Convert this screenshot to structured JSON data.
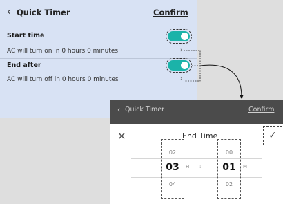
{
  "screen1": {
    "back_icon": "chevron-left-icon",
    "title": "Quick Timer",
    "confirm_label": "Confirm",
    "start_time": {
      "label": "Start time",
      "subtext": "AC will turn on in 0 hours 0 minutes",
      "toggle_on": true
    },
    "end_after": {
      "label": "End after",
      "subtext": "AC will turn off in 0 hours 0 minutes",
      "toggle_on": true
    },
    "toggle_color": "#1bb3a9",
    "background": "#d8e2f4"
  },
  "screen2": {
    "title": "Quick Timer",
    "confirm_label": "Confirm",
    "sheet_title": "End Time",
    "close_icon": "close-icon",
    "check_icon": "checkmark-icon",
    "hours": {
      "prev": "02",
      "selected": "03",
      "next": "04",
      "unit": "H"
    },
    "separator": ":",
    "minutes": {
      "prev": "00",
      "selected": "01",
      "next": "02",
      "unit": "M"
    }
  }
}
